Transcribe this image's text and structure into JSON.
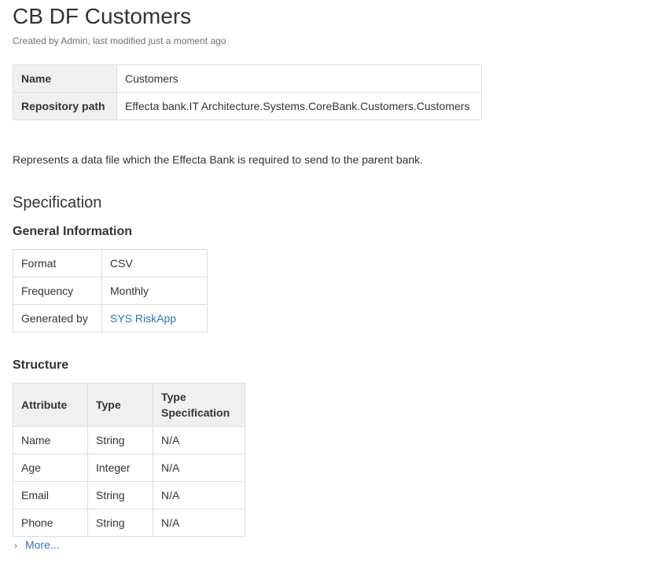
{
  "page": {
    "title": "CB DF Customers",
    "byline": "Created by Admin, last modified just a moment ago"
  },
  "properties": {
    "rows": [
      {
        "key": "Name",
        "value": "Customers"
      },
      {
        "key": "Repository path",
        "value": "Effecta bank.IT Architecture.Systems.CoreBank.Customers.Customers"
      }
    ]
  },
  "description": "Represents a data file which the Effecta Bank is required to send to the parent bank.",
  "specification": {
    "heading": "Specification",
    "general_information": {
      "heading": "General Information",
      "rows": [
        {
          "key": "Format",
          "value": "CSV"
        },
        {
          "key": "Frequency",
          "value": "Monthly"
        },
        {
          "key": "Generated by",
          "value": "SYS RiskApp"
        }
      ]
    },
    "structure": {
      "heading": "Structure",
      "columns": [
        "Attribute",
        "Type",
        "Type Specification"
      ],
      "rows": [
        [
          "Name",
          "String",
          "N/A"
        ],
        [
          "Age",
          "Integer",
          "N/A"
        ],
        [
          "Email",
          "String",
          "N/A"
        ],
        [
          "Phone",
          "String",
          "N/A"
        ]
      ],
      "more_label": "More..."
    }
  },
  "colors": {
    "link": "#3572b0",
    "header_bg": "#f0f0f0",
    "border": "#dddddd"
  },
  "icons": {
    "expand": "chevron-right-icon"
  }
}
